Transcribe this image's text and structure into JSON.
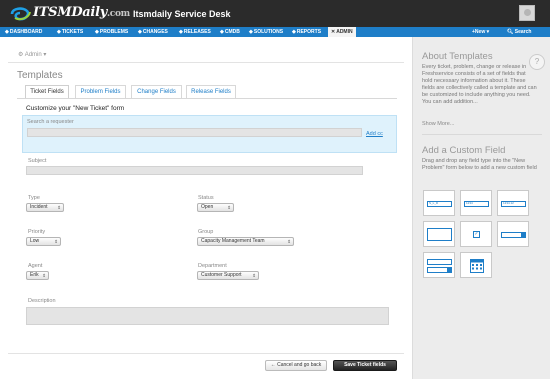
{
  "header": {
    "logo_main": "ITSMDaily",
    "logo_suffix": ".com",
    "app_title": "Itsmdaily Service Desk"
  },
  "nav": {
    "items": [
      {
        "label": "DASHBOARD",
        "icon": "dashboard-icon"
      },
      {
        "label": "TICKETS",
        "icon": "tickets-icon"
      },
      {
        "label": "PROBLEMS",
        "icon": "problems-icon"
      },
      {
        "label": "CHANGES",
        "icon": "changes-icon"
      },
      {
        "label": "RELEASES",
        "icon": "releases-icon"
      },
      {
        "label": "CMDB",
        "icon": "cmdb-icon"
      },
      {
        "label": "SOLUTIONS",
        "icon": "solutions-icon"
      },
      {
        "label": "REPORTS",
        "icon": "reports-icon"
      },
      {
        "label": "ADMIN",
        "icon": "admin-icon"
      }
    ],
    "new_label": "New",
    "search_label": "Search"
  },
  "breadcrumb": "Admin",
  "page_title": "Templates",
  "tabs": [
    "Ticket Fields",
    "Problem Fields",
    "Change Fields",
    "Release Fields"
  ],
  "form": {
    "heading": "Customize your \"New Ticket\" form",
    "requester_placeholder": "Search a requester",
    "add_cc": "Add cc",
    "subject_label": "Subject",
    "type_label": "Type",
    "type_value": "Incident",
    "status_label": "Status",
    "status_value": "Open",
    "priority_label": "Priority",
    "priority_value": "Low",
    "group_label": "Group",
    "group_value": "Capacity Management Team",
    "agent_label": "Agent",
    "agent_value": "Erik",
    "department_label": "Department",
    "department_value": "Customer Support",
    "description_label": "Description"
  },
  "actions": {
    "cancel": "← Cancel and go back",
    "save": "Save Ticket fields"
  },
  "sidebar": {
    "about_title": "About Templates",
    "about_text": "Every ticket, problem, change or release in Freshservice consists of a set of fields that hold necessary information about it. These fields are collectively called a template and can be customized to include anything you need. You can add addition...",
    "show_more": "Show More...",
    "custom_title": "Add a Custom Field",
    "custom_text": "Drag and drop any field type into the \"New Problem\" form below to add a new custom field",
    "tiles": [
      "single-line-text-field",
      "number-field",
      "decimal-field",
      "paragraph-field",
      "checkbox-field",
      "dropdown-field",
      "multi-dropdown-field",
      "date-field"
    ],
    "tile_labels": {
      "single": "S_L_D",
      "number": "1234",
      "decimal": "1234.12"
    }
  },
  "colors": {
    "nav_blue": "#1e7ec8",
    "topbar": "#2b2b2b",
    "requester_bg": "#dff2fc"
  }
}
